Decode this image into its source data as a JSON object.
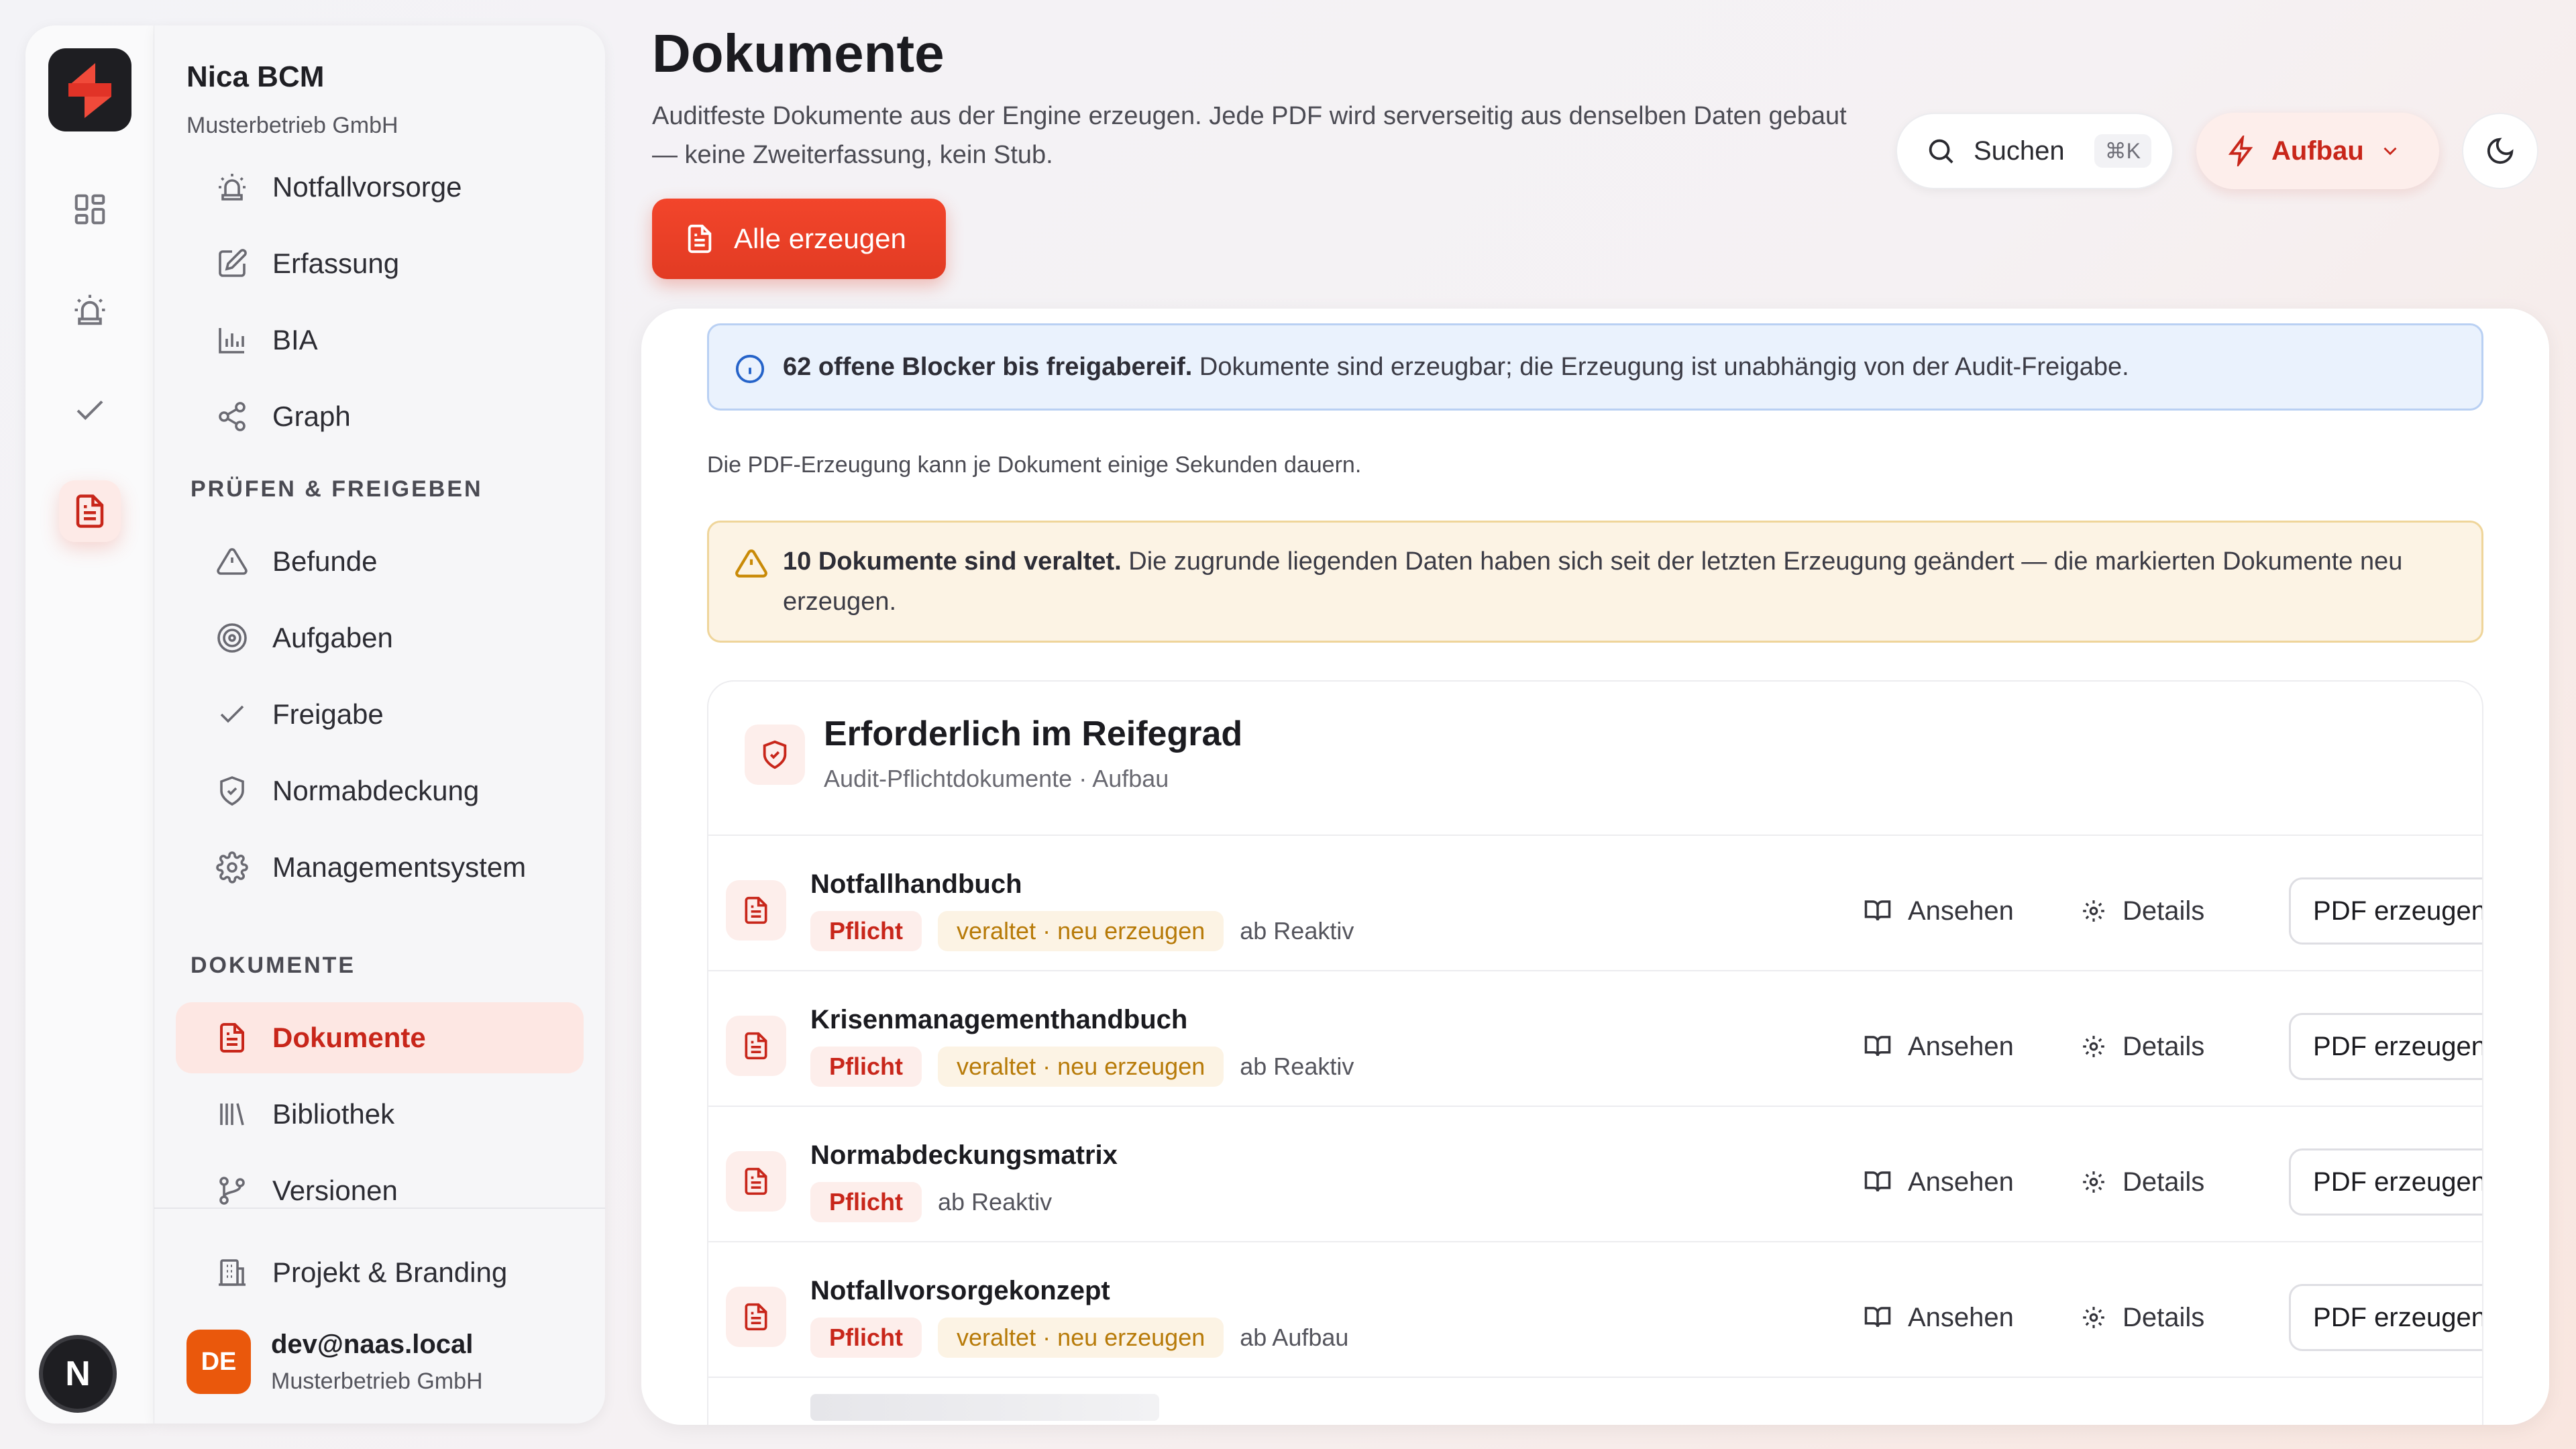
{
  "app": {
    "org_name": "Nica BCM",
    "org_sub": "Musterbetrieb GmbH",
    "user_initial": "N"
  },
  "sidebar": {
    "top_items": [
      {
        "label": "Notfallvorsorge",
        "icon": "siren-icon"
      },
      {
        "label": "Erfassung",
        "icon": "edit-icon"
      },
      {
        "label": "BIA",
        "icon": "bar-chart-icon"
      },
      {
        "label": "Graph",
        "icon": "share-graph-icon"
      }
    ],
    "section_review": "PRÜFEN & FREIGEBEN",
    "review_items": [
      {
        "label": "Befunde",
        "icon": "warning-icon"
      },
      {
        "label": "Aufgaben",
        "icon": "target-icon"
      },
      {
        "label": "Freigabe",
        "icon": "check-icon"
      },
      {
        "label": "Normabdeckung",
        "icon": "shield-check-icon"
      },
      {
        "label": "Managementsystem",
        "icon": "gear-icon"
      }
    ],
    "section_docs": "DOKUMENTE",
    "doc_items": [
      {
        "label": "Dokumente",
        "icon": "document-icon",
        "active": true
      },
      {
        "label": "Bibliothek",
        "icon": "library-icon"
      },
      {
        "label": "Versionen",
        "icon": "branch-icon"
      }
    ],
    "project_label": "Projekt & Branding",
    "user": {
      "initials": "DE",
      "email": "dev@naas.local",
      "org": "Musterbetrieb GmbH"
    }
  },
  "header": {
    "title": "Dokumente",
    "description": "Auditfeste Dokumente aus der Engine erzeugen. Jede PDF wird serverseitig aus denselben Daten gebaut — keine Zweiterfassung, kein Stub.",
    "generate_all": "Alle erzeugen",
    "search_label": "Suchen",
    "search_shortcut": "⌘K",
    "phase_label": "Aufbau"
  },
  "alerts": {
    "info_bold": "62 offene Blocker bis freigabereif.",
    "info_text": " Dokumente sind erzeugbar; die Erzeugung ist unabhängig von der Audit-Freigabe.",
    "note": "Die PDF-Erzeugung kann je Dokument einige Sekunden dauern.",
    "warn_bold": "10 Dokumente sind veraltet.",
    "warn_text": " Die zugrunde liegenden Daten haben sich seit der letzten Erzeugung geändert — die markierten Dokumente neu erzeugen."
  },
  "card": {
    "title": "Erforderlich im Reifegrad",
    "subtitle": "Audit-Pflichtdokumente · Aufbau",
    "actions": {
      "view": "Ansehen",
      "details": "Details",
      "generate": "PDF erzeugen"
    },
    "documents": [
      {
        "name": "Notfallhandbuch",
        "required": "Pflicht",
        "outdated": "veraltet · neu erzeugen",
        "level": "ab Reaktiv"
      },
      {
        "name": "Krisenmanagementhandbuch",
        "required": "Pflicht",
        "outdated": "veraltet · neu erzeugen",
        "level": "ab Reaktiv"
      },
      {
        "name": "Normabdeckungsmatrix",
        "required": "Pflicht",
        "outdated": "",
        "level": "ab Reaktiv"
      },
      {
        "name": "Notfallvorsorgekonzept",
        "required": "Pflicht",
        "outdated": "veraltet · neu erzeugen",
        "level": "ab Aufbau"
      }
    ]
  },
  "colors": {
    "accent": "#e23b23",
    "accent_dark": "#c8261a",
    "info": "#2563c9",
    "warn": "#c98a07"
  }
}
